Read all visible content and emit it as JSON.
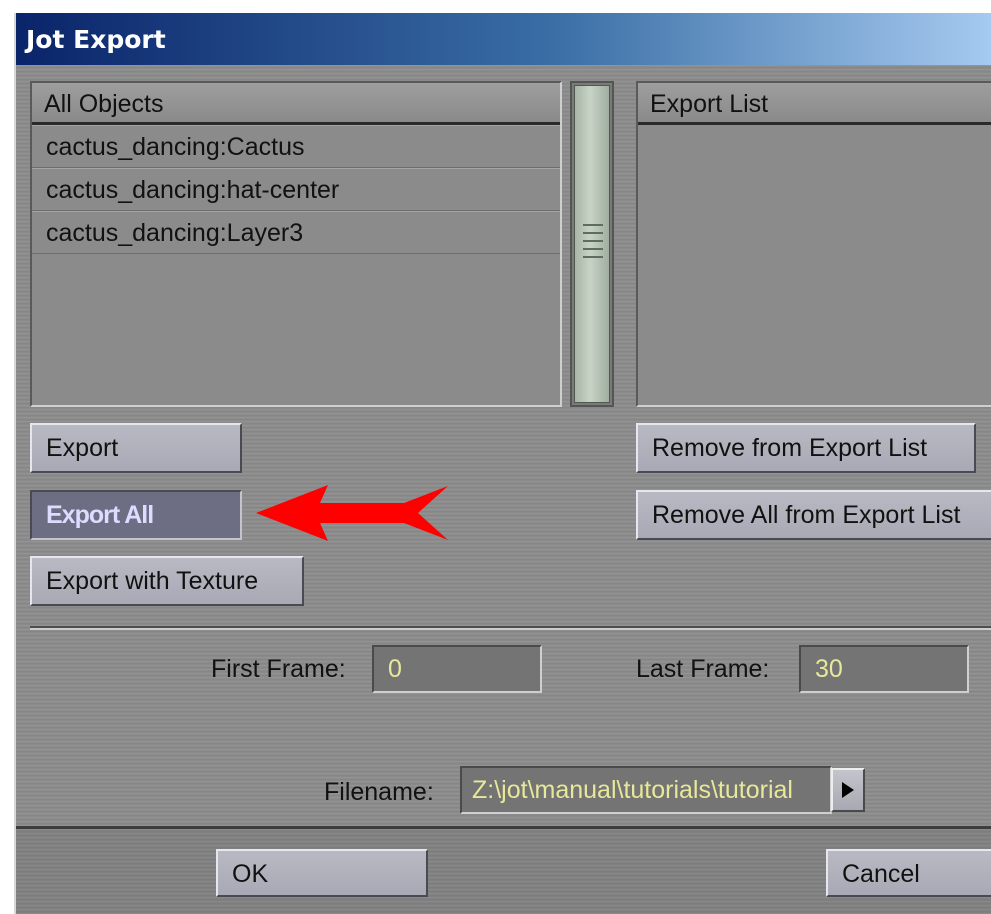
{
  "window": {
    "title": "Jot Export"
  },
  "all_objects": {
    "header": "All Objects",
    "items": [
      "cactus_dancing:Cactus",
      "cactus_dancing:hat-center",
      "cactus_dancing:Layer3"
    ]
  },
  "export_list": {
    "header": "Export List",
    "items": []
  },
  "buttons": {
    "export": "Export",
    "export_all": "Export All",
    "export_with_texture": "Export with Texture",
    "remove_from_export_list": "Remove from Export List",
    "remove_all_from_export_list": "Remove All from Export List"
  },
  "frames": {
    "first_label": "First Frame:",
    "first_value": "0",
    "last_label": "Last Frame:",
    "last_value": "30"
  },
  "filename": {
    "label": "Filename:",
    "value": "Z:\\jot\\manual\\tutorials\\tutorial"
  },
  "footer": {
    "ok": "OK",
    "cancel": "Cancel"
  },
  "colors": {
    "title_gradient_start": "#0a246a",
    "title_gradient_end": "#a6caf0",
    "panel_bg": "#8c8c8c",
    "field_text": "#e8e89a",
    "annotation_arrow": "#ff0000"
  }
}
